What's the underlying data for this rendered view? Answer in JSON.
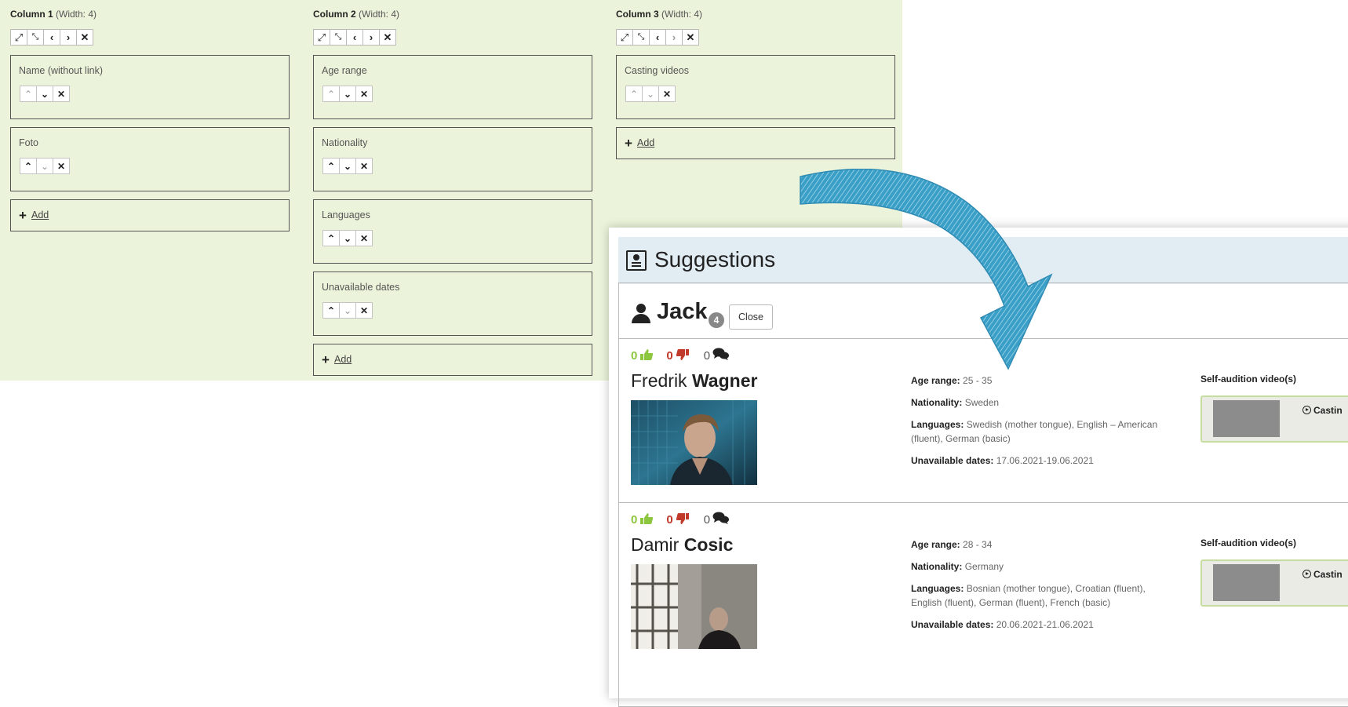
{
  "editor": {
    "columns": [
      {
        "title": "Column 1",
        "width_label": "(Width: 4)",
        "fields": [
          {
            "label": "Name (without link)"
          },
          {
            "label": "Foto"
          }
        ],
        "add_label": "Add"
      },
      {
        "title": "Column 2",
        "width_label": "(Width: 4)",
        "fields": [
          {
            "label": "Age range"
          },
          {
            "label": "Nationality"
          },
          {
            "label": "Languages"
          },
          {
            "label": "Unavailable dates"
          }
        ],
        "add_label": "Add"
      },
      {
        "title": "Column 3",
        "width_label": "(Width: 4)",
        "fields": [
          {
            "label": "Casting videos"
          }
        ],
        "add_label": "Add"
      }
    ],
    "column_controls": [
      "expand-icon",
      "shrink-icon",
      "chevron-left-icon",
      "chevron-right-icon",
      "close-icon"
    ],
    "field_controls": [
      "chevron-up-icon",
      "chevron-down-icon",
      "close-icon"
    ]
  },
  "suggestions": {
    "title": "Suggestions",
    "role_name": "Jack",
    "role_badge": "4",
    "close_label": "Close",
    "candidates": [
      {
        "votes": {
          "up": "0",
          "down": "0",
          "comments": "0"
        },
        "first_name": "Fredrik",
        "last_name": "Wagner",
        "age_range": {
          "label": "Age range:",
          "value": "25 - 35"
        },
        "nationality": {
          "label": "Nationality:",
          "value": "Sweden"
        },
        "languages": {
          "label": "Languages:",
          "value": "Swedish (mother tongue), English – American (fluent), German (basic)"
        },
        "unavailable": {
          "label": "Unavailable dates:",
          "value": "17.06.2021-19.06.2021"
        },
        "video_heading": "Self-audition video(s)",
        "video_label": "Castin"
      },
      {
        "votes": {
          "up": "0",
          "down": "0",
          "comments": "0"
        },
        "first_name": "Damir",
        "last_name": "Cosic",
        "age_range": {
          "label": "Age range:",
          "value": "28 - 34"
        },
        "nationality": {
          "label": "Nationality:",
          "value": "Germany"
        },
        "languages": {
          "label": "Languages:",
          "value": "Bosnian (mother tongue), Croatian (fluent), English (fluent), German (fluent), French (basic)"
        },
        "unavailable": {
          "label": "Unavailable dates:",
          "value": "20.06.2021-21.06.2021"
        },
        "video_heading": "Self-audition video(s)",
        "video_label": "Castin"
      }
    ]
  },
  "colors": {
    "editor_bg": "#ebf4da",
    "header_bg": "#e1ecf3",
    "upvote": "#8dc63f",
    "downvote": "#c0392b",
    "arrow": "#3a9fc7"
  }
}
